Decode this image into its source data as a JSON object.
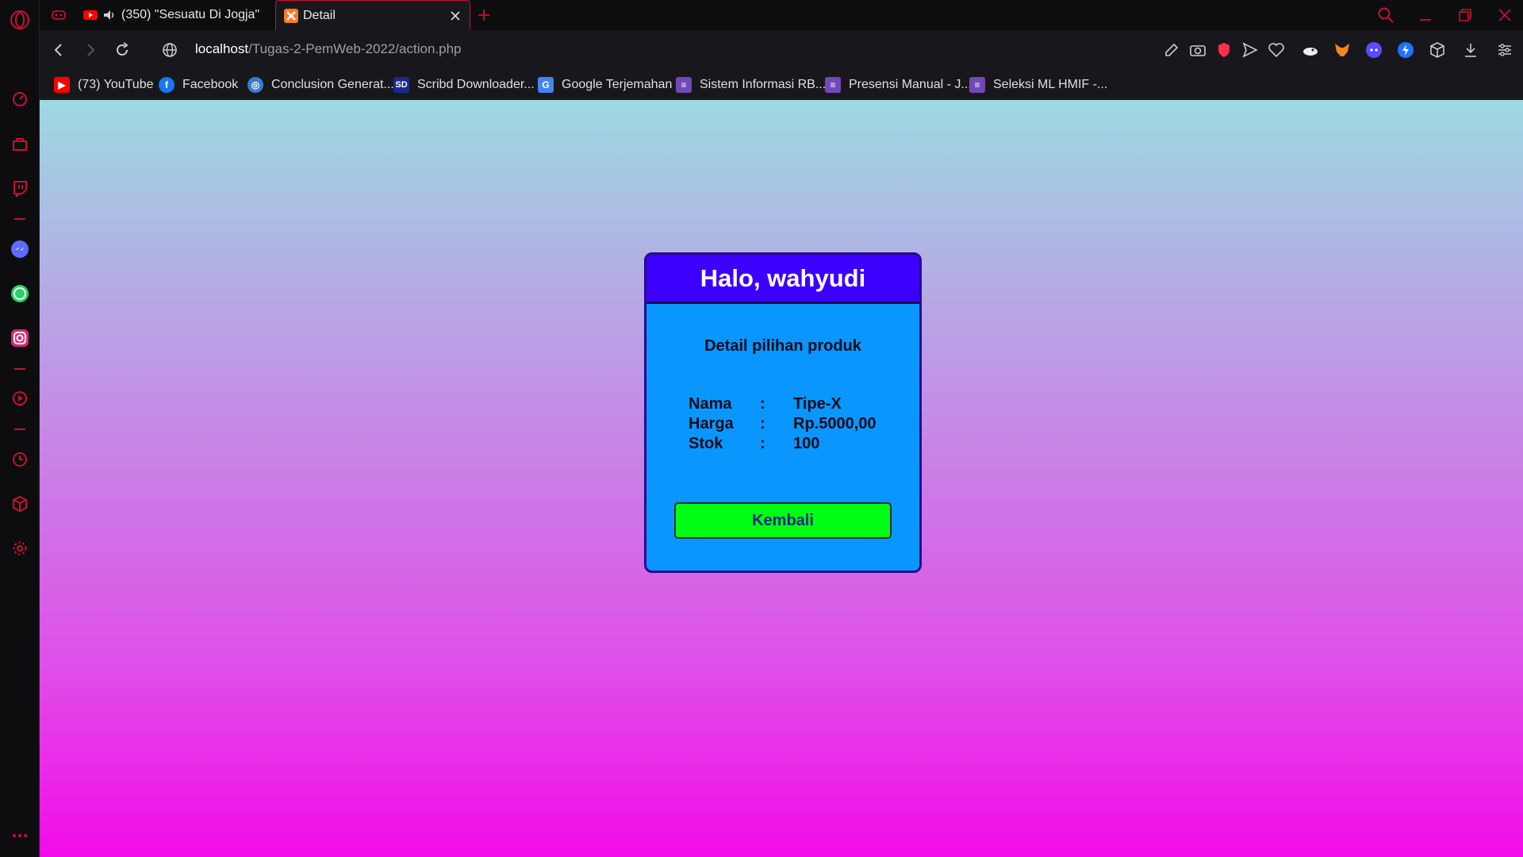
{
  "colors": {
    "accent": "#c8102e",
    "header_bg": "#3b00ff",
    "card_bg": "#0a96ff",
    "button_bg": "#00ff14"
  },
  "tabs": [
    {
      "title": "(350) \"Sesuatu Di Jogja\"",
      "favicon": "youtube-icon",
      "audio": true
    },
    {
      "title": "Detail",
      "favicon": "xampp-icon",
      "active": true
    }
  ],
  "address": {
    "host": "localhost",
    "path": "/Tugas-2-PemWeb-2022/action.php"
  },
  "bookmarks": [
    {
      "label": "(73) YouTube",
      "icon": "youtube-icon"
    },
    {
      "label": "Facebook",
      "icon": "facebook-icon"
    },
    {
      "label": "Conclusion Generat...",
      "icon": "globe-icon"
    },
    {
      "label": "Scribd Downloader...",
      "icon": "sd-icon",
      "icon_text": "SD"
    },
    {
      "label": "Google Terjemahan",
      "icon": "translate-icon"
    },
    {
      "label": "Sistem Informasi RB...",
      "icon": "forms-icon"
    },
    {
      "label": "Presensi Manual - J...",
      "icon": "forms-icon"
    },
    {
      "label": "Seleksi ML HMIF -...",
      "icon": "forms-icon"
    }
  ],
  "page": {
    "greeting": "Halo, wahyudi",
    "subtitle": "Detail pilihan produk",
    "details": [
      {
        "label": "Nama",
        "sep": ":",
        "value": "Tipe-X"
      },
      {
        "label": "Harga",
        "sep": ":",
        "value": "Rp.5000,00"
      },
      {
        "label": "Stok",
        "sep": ":",
        "value": "100"
      }
    ],
    "back_label": "Kembali"
  },
  "sidebar_menu": "..."
}
